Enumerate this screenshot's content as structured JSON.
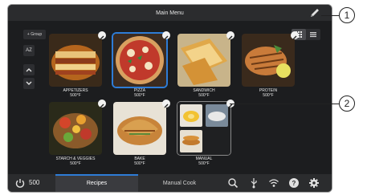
{
  "header": {
    "title": "Main Menu",
    "edit_icon": "pencil-icon"
  },
  "sidebar": {
    "group_label": "+ Group",
    "sort_label": "AZ",
    "up_icon": "chevron-up-icon",
    "down_icon": "chevron-down-icon"
  },
  "view_toggle": {
    "grid_icon": "grid-view-icon",
    "list_icon": "list-view-icon"
  },
  "recipes": [
    {
      "name": "APPETIZERS",
      "temp": "500°F",
      "selected": false
    },
    {
      "name": "PIZZA",
      "temp": "500°F",
      "selected": true
    },
    {
      "name": "SANDWICH",
      "temp": "500°F",
      "selected": false
    },
    {
      "name": "PROTEIN",
      "temp": "500°F",
      "selected": false
    },
    {
      "name": "STARCH & VEGGIES",
      "temp": "500°F",
      "selected": false
    },
    {
      "name": "BAKE",
      "temp": "500°F",
      "selected": false
    },
    {
      "name": "MANUAL",
      "temp": "500°F",
      "selected": false
    }
  ],
  "bottom_bar": {
    "power_icon": "power-icon",
    "temperature": "500",
    "tabs": [
      {
        "label": "Recipes",
        "active": true
      },
      {
        "label": "Manual Cook",
        "active": false
      }
    ],
    "icons": [
      "search-icon",
      "usb-icon",
      "wifi-icon",
      "help-icon",
      "gear-icon"
    ]
  },
  "callouts": [
    "1",
    "2"
  ],
  "colors": {
    "accent": "#2e7cd6",
    "background": "#1c1d1f",
    "bar": "#2b2c2e"
  }
}
